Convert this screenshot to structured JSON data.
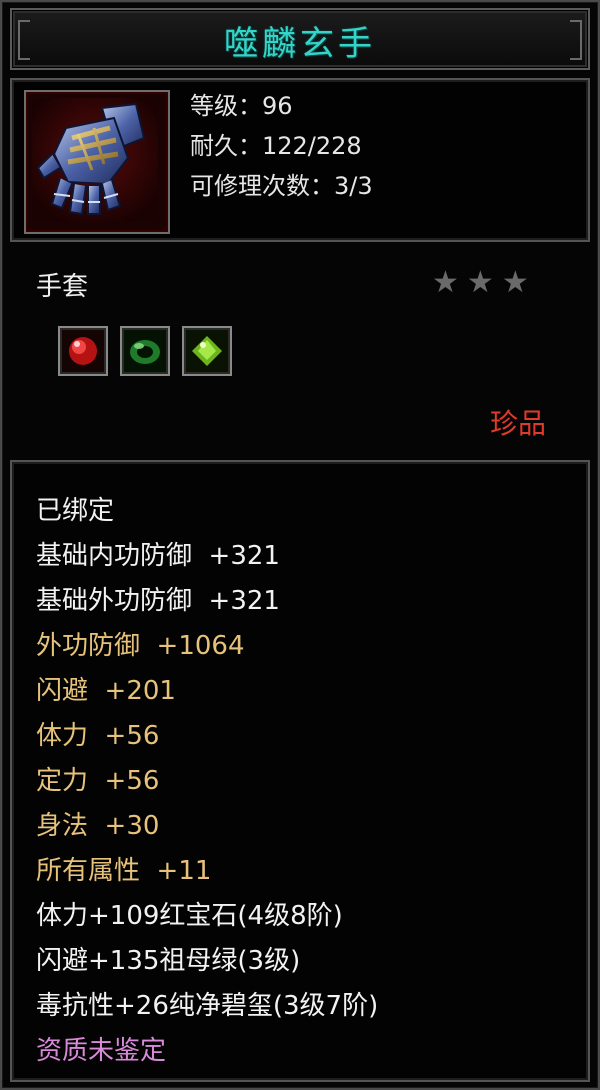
{
  "item": {
    "name": "噬麟玄手",
    "level_text": "等级：96",
    "durability_text": "耐久：122/228",
    "repair_text": "可修理次数：3/3",
    "icon": "gauntlet-icon",
    "type": "手套",
    "stars": {
      "filled": 0,
      "total": 3
    },
    "gems": [
      {
        "icon": "ruby-gem-icon",
        "color": "#c21b1b"
      },
      {
        "icon": "emerald-ring-gem-icon",
        "color": "#2f9a3a"
      },
      {
        "icon": "jade-gem-icon",
        "color": "#7fc22a"
      }
    ],
    "rarity": "珍品"
  },
  "attributes": [
    {
      "text": "已绑定",
      "color": "white"
    },
    {
      "text": "基础内功防御  +321",
      "color": "white"
    },
    {
      "text": "基础外功防御  +321",
      "color": "white"
    },
    {
      "text": "外功防御  +1064",
      "color": "gold"
    },
    {
      "text": "闪避  +201",
      "color": "gold"
    },
    {
      "text": "体力  +56",
      "color": "gold"
    },
    {
      "text": "定力  +56",
      "color": "gold"
    },
    {
      "text": "身法  +30",
      "color": "gold"
    },
    {
      "text": "所有属性  +11",
      "color": "gold"
    },
    {
      "text": "体力+109红宝石(4级8阶)",
      "color": "white"
    },
    {
      "text": "闪避+135祖母绿(3级)",
      "color": "white"
    },
    {
      "text": "毒抗性+26纯净碧玺(3级7阶)",
      "color": "white"
    },
    {
      "text": "资质未鉴定",
      "color": "pink"
    }
  ],
  "colors": {
    "title": "#35d4c8",
    "rarity": "#e03a2a",
    "gold_attr": "#e6c27a",
    "pink_attr": "#d889d8"
  }
}
